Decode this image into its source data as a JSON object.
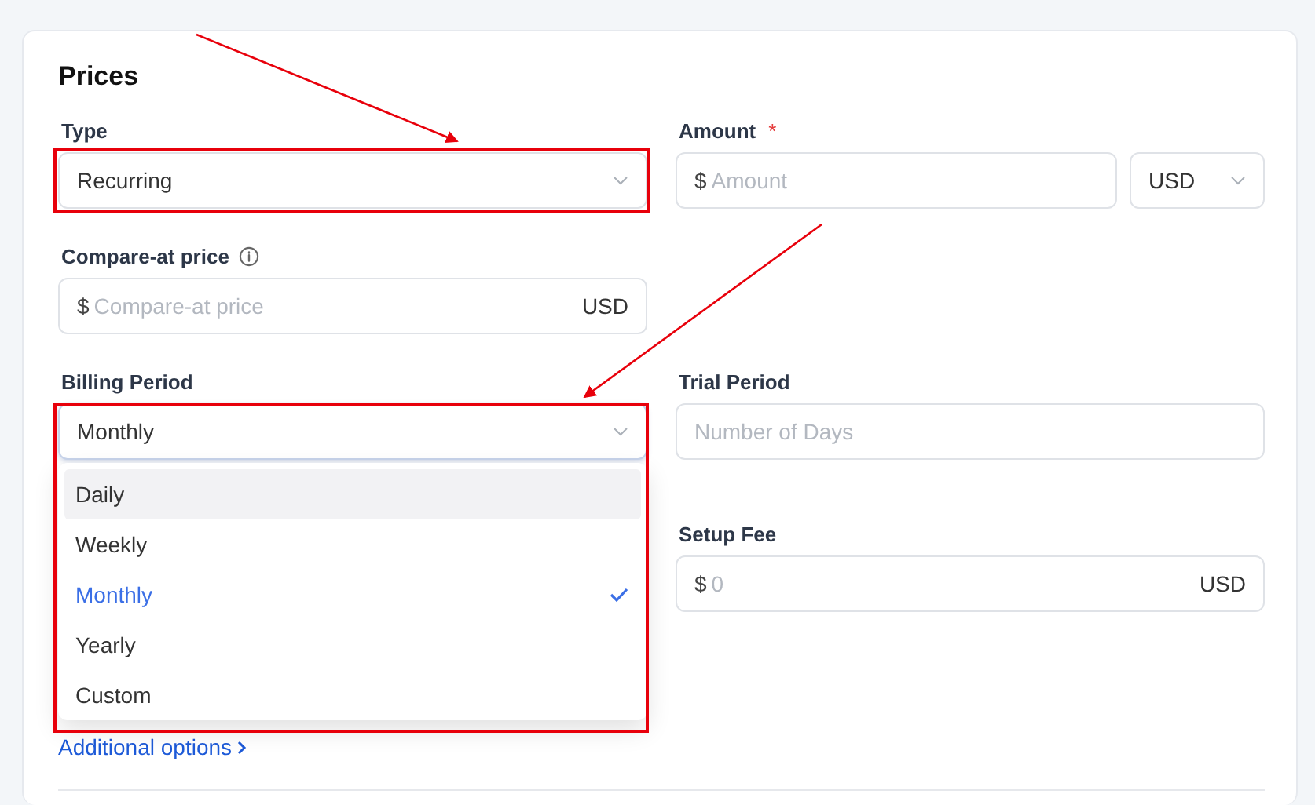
{
  "section": {
    "title": "Prices"
  },
  "type_field": {
    "label": "Type",
    "value": "Recurring"
  },
  "amount_field": {
    "label": "Amount",
    "required_mark": "*",
    "prefix": "$",
    "placeholder": "Amount",
    "currency": "USD"
  },
  "compare_at_field": {
    "label": "Compare-at price",
    "prefix": "$",
    "placeholder": "Compare-at price",
    "suffix": "USD"
  },
  "billing_period_field": {
    "label": "Billing Period",
    "value": "Monthly",
    "expanded": true,
    "options": [
      {
        "label": "Daily",
        "highlighted": true,
        "selected": false
      },
      {
        "label": "Weekly",
        "highlighted": false,
        "selected": false
      },
      {
        "label": "Monthly",
        "highlighted": false,
        "selected": true
      },
      {
        "label": "Yearly",
        "highlighted": false,
        "selected": false
      },
      {
        "label": "Custom",
        "highlighted": false,
        "selected": false
      }
    ]
  },
  "trial_period_field": {
    "label": "Trial Period",
    "placeholder": "Number of Days"
  },
  "setup_fee_field": {
    "label": "Setup Fee",
    "prefix": "$",
    "placeholder": "0",
    "suffix": "USD"
  },
  "additional_options_link": {
    "label": "Additional options"
  }
}
